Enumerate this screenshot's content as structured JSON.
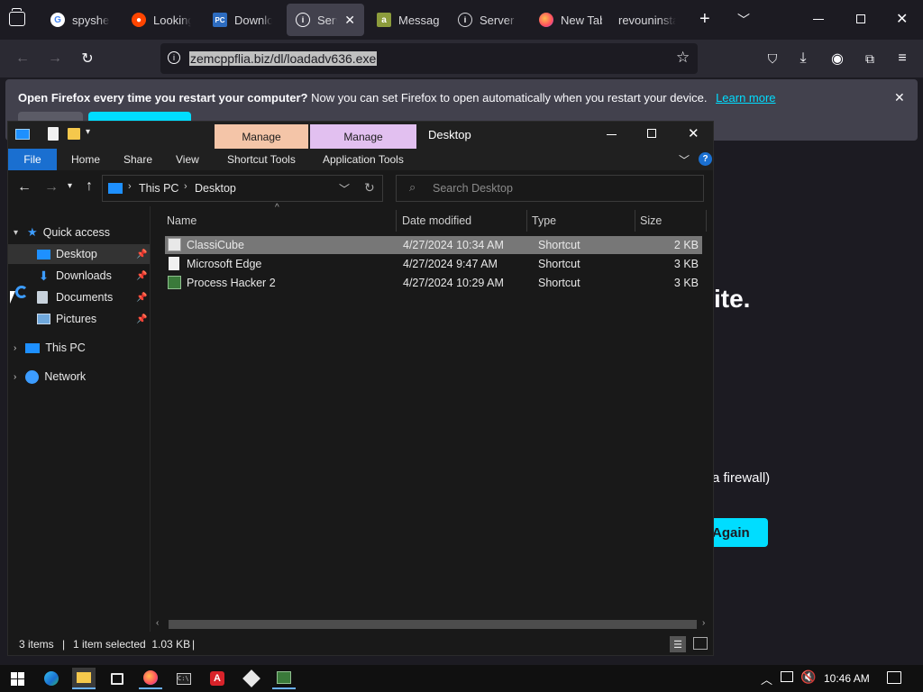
{
  "browser": {
    "tabs": [
      {
        "label": "spysheri",
        "icon": "google-icon"
      },
      {
        "label": "Looking",
        "icon": "reddit-icon"
      },
      {
        "label": "Downlo",
        "icon": "pc-icon"
      },
      {
        "label": "Server",
        "icon": "info-icon"
      },
      {
        "label": "Message",
        "icon": "amazon-icon"
      },
      {
        "label": "Server N",
        "icon": "info-icon"
      },
      {
        "label": "New Tab",
        "icon": "firefox-icon"
      },
      {
        "label": "revouninstall",
        "icon": ""
      }
    ],
    "url": "zemcppflia.biz/dl/loadadv636.exe",
    "notification": {
      "bold": "Open Firefox every time you restart your computer?",
      "text": "Now you can set Firefox to open automatically when you restart your device.",
      "link": "Learn more"
    },
    "page_fragments": {
      "heading_tail": "ite.",
      "firewall_tail": "a firewall)",
      "button_tail": "Again"
    }
  },
  "explorer": {
    "title": "Desktop",
    "context_tabs": [
      "Manage",
      "Manage"
    ],
    "ribbon_tabs": [
      "File",
      "Home",
      "Share",
      "View",
      "Shortcut Tools",
      "Application Tools"
    ],
    "breadcrumb": [
      "This PC",
      "Desktop"
    ],
    "search_placeholder": "Search Desktop",
    "nav": {
      "quick_access": "Quick access",
      "items": [
        "Desktop",
        "Downloads",
        "Documents",
        "Pictures"
      ],
      "this_pc": "This PC",
      "network": "Network"
    },
    "columns": [
      "Name",
      "Date modified",
      "Type",
      "Size"
    ],
    "files": [
      {
        "name": "ClassiCube",
        "date": "4/27/2024 10:34 AM",
        "type": "Shortcut",
        "size": "2 KB"
      },
      {
        "name": "Microsoft Edge",
        "date": "4/27/2024 9:47 AM",
        "type": "Shortcut",
        "size": "3 KB"
      },
      {
        "name": "Process Hacker 2",
        "date": "4/27/2024 10:29 AM",
        "type": "Shortcut",
        "size": "3 KB"
      }
    ],
    "status": {
      "count": "3 items",
      "selection": "1 item selected  1.03 KB"
    }
  },
  "taskbar": {
    "time": "10:46 AM"
  },
  "colors": {
    "ctx_manage_1": "#f4c5a8",
    "ctx_manage_2": "#e2c0f0",
    "file_tab": "#1a6fd0",
    "accent": "#00ddff"
  }
}
